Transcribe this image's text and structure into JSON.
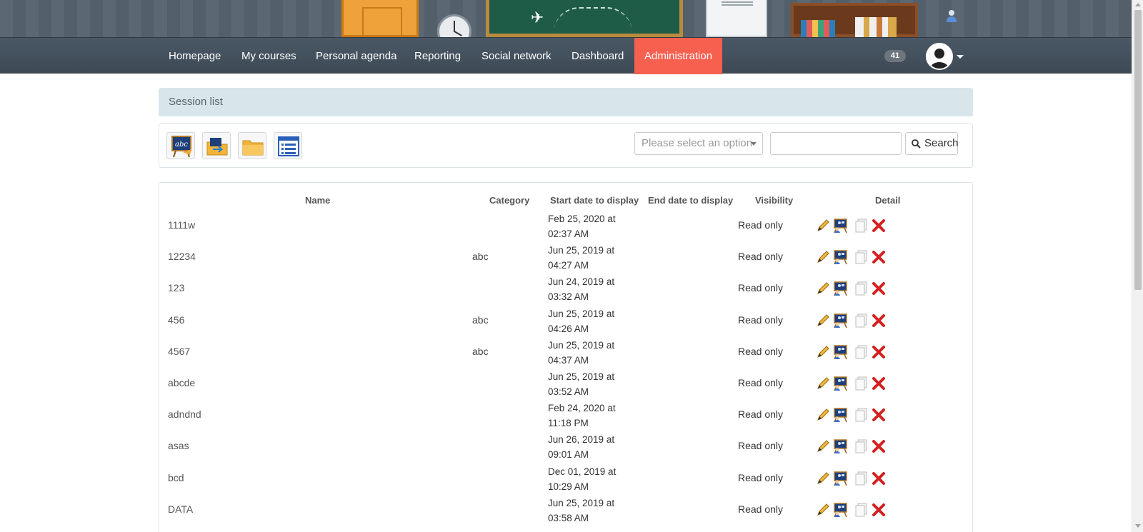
{
  "nav": {
    "items": [
      {
        "label": "Homepage"
      },
      {
        "label": "My courses"
      },
      {
        "label": "Personal agenda"
      },
      {
        "label": "Reporting"
      },
      {
        "label": "Social network"
      },
      {
        "label": "Dashboard"
      },
      {
        "label": "Administration",
        "active": true
      }
    ],
    "notification_count": "41",
    "active_color": "#f75f4f"
  },
  "breadcrumb": {
    "label": "Session list"
  },
  "toolbar": {
    "icons": [
      "add-session-icon",
      "import-sessions-icon",
      "export-sessions-icon",
      "session-list-view-icon"
    ],
    "select_placeholder": "Please select an option",
    "search_value": "",
    "search_label": "Search"
  },
  "table": {
    "headers": {
      "name": "Name",
      "category": "Category",
      "start": "Start date to display",
      "end": "End date to display",
      "visibility": "Visibility",
      "detail": "Detail"
    },
    "rows": [
      {
        "name": "1111w",
        "category": "",
        "start": "Feb 25, 2020 at 02:37 AM",
        "end": "",
        "visibility": "Read only"
      },
      {
        "name": "12234",
        "category": "abc",
        "start": "Jun 25, 2019 at 04:27 AM",
        "end": "",
        "visibility": "Read only"
      },
      {
        "name": "123",
        "category": "",
        "start": "Jun 24, 2019 at 03:32 AM",
        "end": "",
        "visibility": "Read only"
      },
      {
        "name": "456",
        "category": "abc",
        "start": "Jun 25, 2019 at 04:26 AM",
        "end": "",
        "visibility": "Read only"
      },
      {
        "name": "4567",
        "category": "abc",
        "start": "Jun 25, 2019 at 04:37 AM",
        "end": "",
        "visibility": "Read only"
      },
      {
        "name": "abcde",
        "category": "",
        "start": "Jun 25, 2019 at 03:52 AM",
        "end": "",
        "visibility": "Read only"
      },
      {
        "name": "adndnd",
        "category": "",
        "start": "Feb 24, 2020 at 11:18 PM",
        "end": "",
        "visibility": "Read only"
      },
      {
        "name": "asas",
        "category": "",
        "start": "Jun 26, 2019 at 09:01 AM",
        "end": "",
        "visibility": "Read only"
      },
      {
        "name": "bcd",
        "category": "",
        "start": "Dec 01, 2019 at 10:29 AM",
        "end": "",
        "visibility": "Read only"
      },
      {
        "name": "DATA",
        "category": "",
        "start": "Jun 25, 2019 at 03:58 AM",
        "end": "",
        "visibility": "Read only"
      }
    ],
    "row_actions": [
      "edit-icon",
      "subscribe-users-icon",
      "copy-icon",
      "delete-icon"
    ]
  }
}
